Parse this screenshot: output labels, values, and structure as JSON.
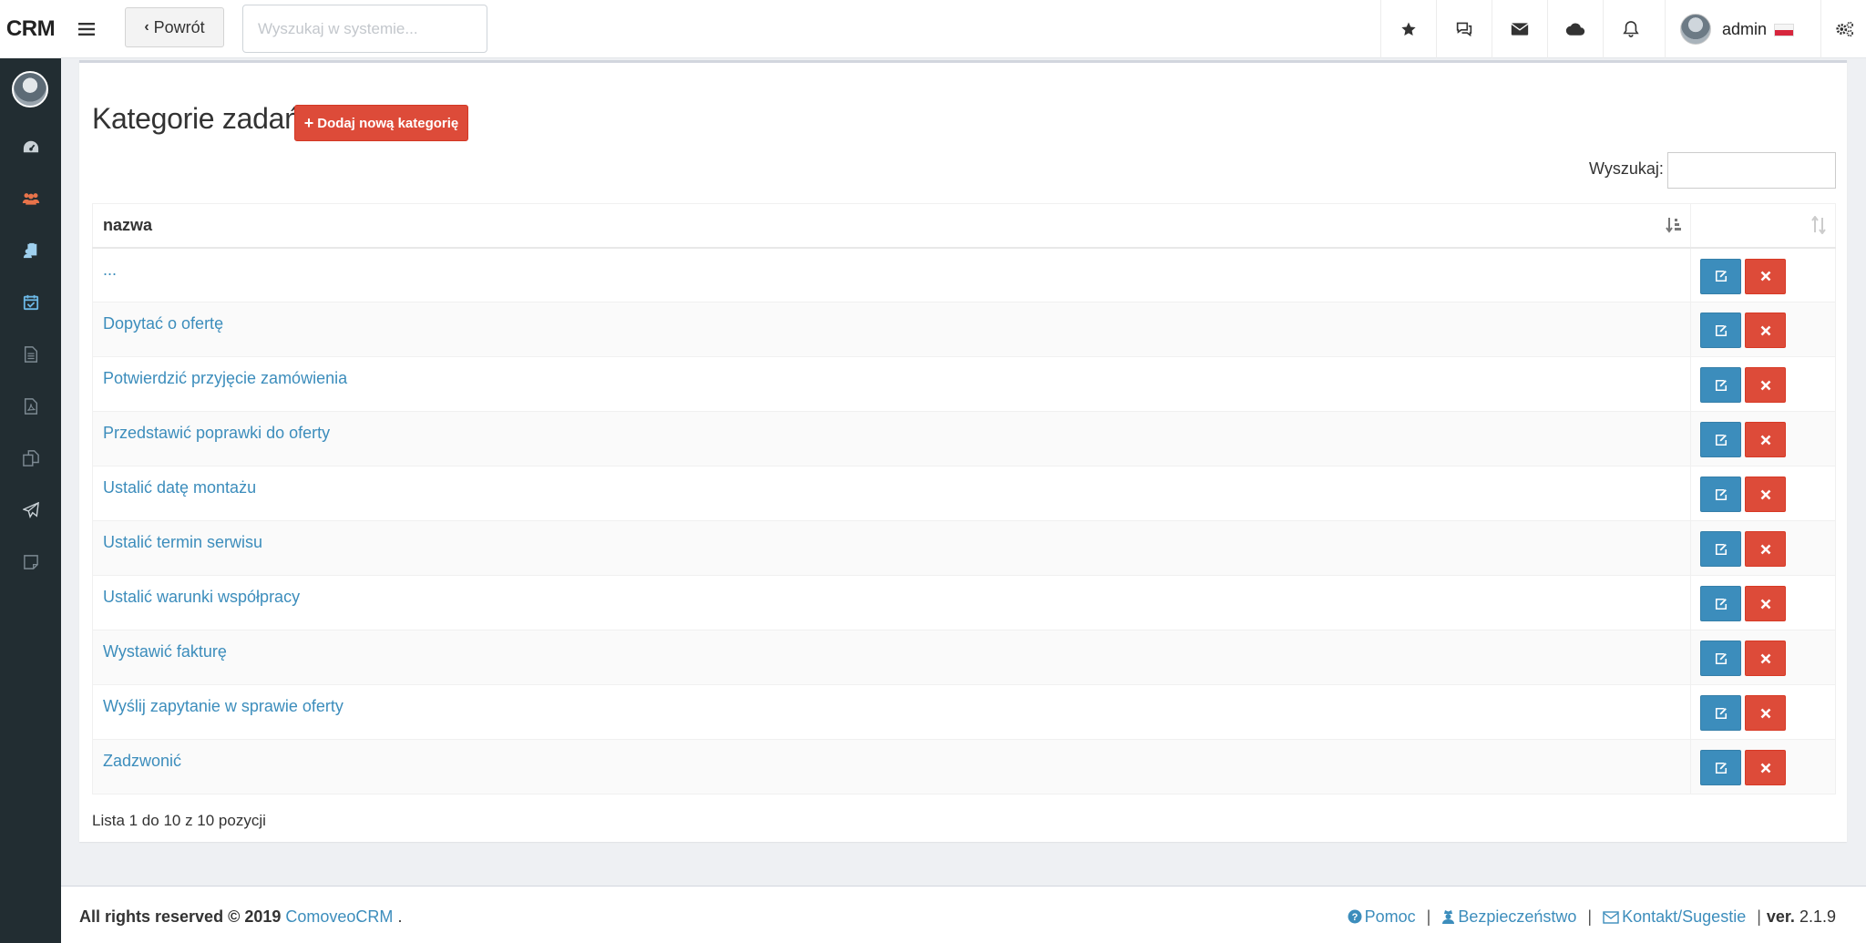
{
  "header": {
    "brand": "CRM",
    "back_label": "Powrót",
    "search_placeholder": "Wyszukaj w systemie...",
    "user_name": "admin"
  },
  "page": {
    "title": "Kategorie zadań",
    "add_button_label": "Dodaj nową kategorię",
    "filter_label": "Wyszukaj:",
    "filter_value": ""
  },
  "table": {
    "columns": [
      "nazwa",
      ""
    ],
    "rows": [
      {
        "name": "..."
      },
      {
        "name": "Dopytać o ofertę"
      },
      {
        "name": "Potwierdzić przyjęcie zamówienia"
      },
      {
        "name": "Przedstawić poprawki do oferty"
      },
      {
        "name": "Ustalić datę montażu"
      },
      {
        "name": "Ustalić termin serwisu"
      },
      {
        "name": "Ustalić warunki współpracy"
      },
      {
        "name": "Wystawić fakturę"
      },
      {
        "name": "Wyślij zapytanie w sprawie oferty"
      },
      {
        "name": "Zadzwonić"
      }
    ]
  },
  "list_info": "Lista 1 do 10 z 10 pozycji",
  "footer": {
    "copyright": "All rights reserved © 2019",
    "company": "ComoveoCRM",
    "company_suffix": ".",
    "help": "Pomoc",
    "security": "Bezpieczeństwo",
    "contact": "Kontakt/Sugestie",
    "version_label": "ver.",
    "version": "2.1.9"
  },
  "colors": {
    "primary": "#3c8dbc",
    "danger": "#dd4b39",
    "sidebar": "#222d32"
  }
}
